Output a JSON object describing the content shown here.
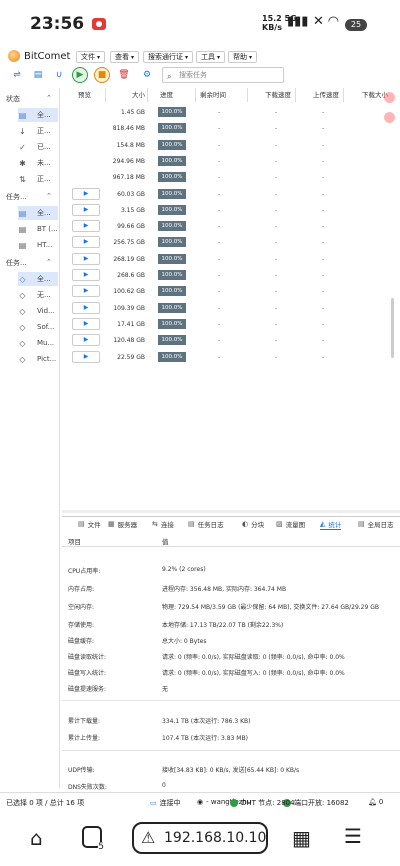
{
  "statusbar": {
    "clock": "23:56",
    "net_speed": "15.2 5G",
    "net_unit": "KB/s",
    "battery": "25"
  },
  "app": {
    "title": "BitComet"
  },
  "menus": [
    {
      "label": "文件"
    },
    {
      "label": "查看"
    },
    {
      "label": "搜索通行证"
    },
    {
      "label": "工具"
    },
    {
      "label": "帮助"
    }
  ],
  "search": {
    "placeholder": "搜索任务"
  },
  "sidebar": {
    "section_status": "状态",
    "status_items": [
      "全...",
      "正...",
      "已...",
      "未...",
      "正..."
    ],
    "section_tasks": "任务...",
    "task_items": [
      "全...",
      "BT (...",
      "HT..."
    ],
    "section_tags": "任务...",
    "tag_items": [
      "全...",
      "无...",
      "Vid...",
      "Sof...",
      "Mu...",
      "Pict..."
    ]
  },
  "table": {
    "headers": [
      "预览",
      "大小",
      "进度",
      "剩余时间",
      "下载速度",
      "上传速度",
      "下载大小"
    ],
    "rows": [
      {
        "size": "1.45 GB",
        "progress": "100.0%",
        "play": false
      },
      {
        "size": "818.46 MB",
        "progress": "100.0%",
        "play": false
      },
      {
        "size": "154.8 MB",
        "progress": "100.0%",
        "play": false
      },
      {
        "size": "294.96 MB",
        "progress": "100.0%",
        "play": false
      },
      {
        "size": "967.18 MB",
        "progress": "100.0%",
        "play": false
      },
      {
        "size": "60.03 GB",
        "progress": "100.0%",
        "play": true
      },
      {
        "size": "3.15 GB",
        "progress": "100.0%",
        "play": true
      },
      {
        "size": "99.66 GB",
        "progress": "100.0%",
        "play": true
      },
      {
        "size": "256.75 GB",
        "progress": "100.0%",
        "play": true
      },
      {
        "size": "268.19 GB",
        "progress": "100.0%",
        "play": true
      },
      {
        "size": "268.6 GB",
        "progress": "100.0%",
        "play": true
      },
      {
        "size": "100.62 GB",
        "progress": "100.0%",
        "play": true
      },
      {
        "size": "109.39 GB",
        "progress": "100.0%",
        "play": true
      },
      {
        "size": "17.41 GB",
        "progress": "100.0%",
        "play": true
      },
      {
        "size": "120.48 GB",
        "progress": "100.0%",
        "play": true
      },
      {
        "size": "22.59 GB",
        "progress": "100.0%",
        "play": true
      }
    ],
    "dash": "-"
  },
  "tabs": [
    {
      "label": "文件",
      "icon": "file-icon"
    },
    {
      "label": "服务器",
      "icon": "server-icon"
    },
    {
      "label": "连接",
      "icon": "link-icon"
    },
    {
      "label": "任务日志",
      "icon": "log-icon"
    },
    {
      "label": "分块",
      "icon": "block-icon"
    },
    {
      "label": "流量图",
      "icon": "graph-icon"
    },
    {
      "label": "统计",
      "icon": "stats-icon"
    },
    {
      "label": "全局日志",
      "icon": "global-log-icon"
    }
  ],
  "stats": {
    "col_item": "项目",
    "col_value": "值",
    "rows": [
      {
        "k": "CPU占用率:",
        "v": "9.2% (2 cores)"
      },
      {
        "k": "内存占用:",
        "v": "进程内存: 356.48 MB, 实际内存: 364.74 MB"
      },
      {
        "k": "空闲内存:",
        "v": "物理: 729.54 MB/3.59 GB (最少保留: 64 MB), 交换文件: 27.64 GB/29.29 GB"
      },
      {
        "k": "存储使用:",
        "v": "本地存储: 17.13 TB/22.07 TB (剩余22.3%)"
      },
      {
        "k": "磁盘缓存:",
        "v": "总大小: 0 Bytes"
      },
      {
        "k": "磁盘读取统计:",
        "v": "请求: 0 (频率: 0.0/s), 实际磁盘读取: 0 (频率: 0.0/s), 命中率: 0.0%"
      },
      {
        "k": "磁盘写入统计:",
        "v": "请求: 0 (频率: 0.0/s), 实际磁盘写入: 0 (频率: 0.0/s), 命中率: 0.0%"
      },
      {
        "k": "磁盘提速服务:",
        "v": "无"
      },
      {
        "k": "累计下载量:",
        "v": "334.1 TB (本次运行: 786.3 KB)"
      },
      {
        "k": "累计上传量:",
        "v": "107.4 TB (本次运行: 3.83 MB)"
      },
      {
        "k": "UDP传输:",
        "v": "接收[34.83 KB]: 0 KB/s, 发送[65.44 KB]: 0 KB/s"
      },
      {
        "k": "DNS失败次数:",
        "v": "0"
      }
    ]
  },
  "bottom": {
    "selected": "已选择 0 项 / 总计 16 项",
    "connection": "连接中",
    "user": "- wangtiezhu",
    "dht_label": "DHT 节点:",
    "dht_value": "2804",
    "port_label": "端口开放:",
    "port_value": "16082",
    "alerts": "0"
  },
  "navbar": {
    "tab_count": "5",
    "url": "192.168.10.103:6"
  }
}
